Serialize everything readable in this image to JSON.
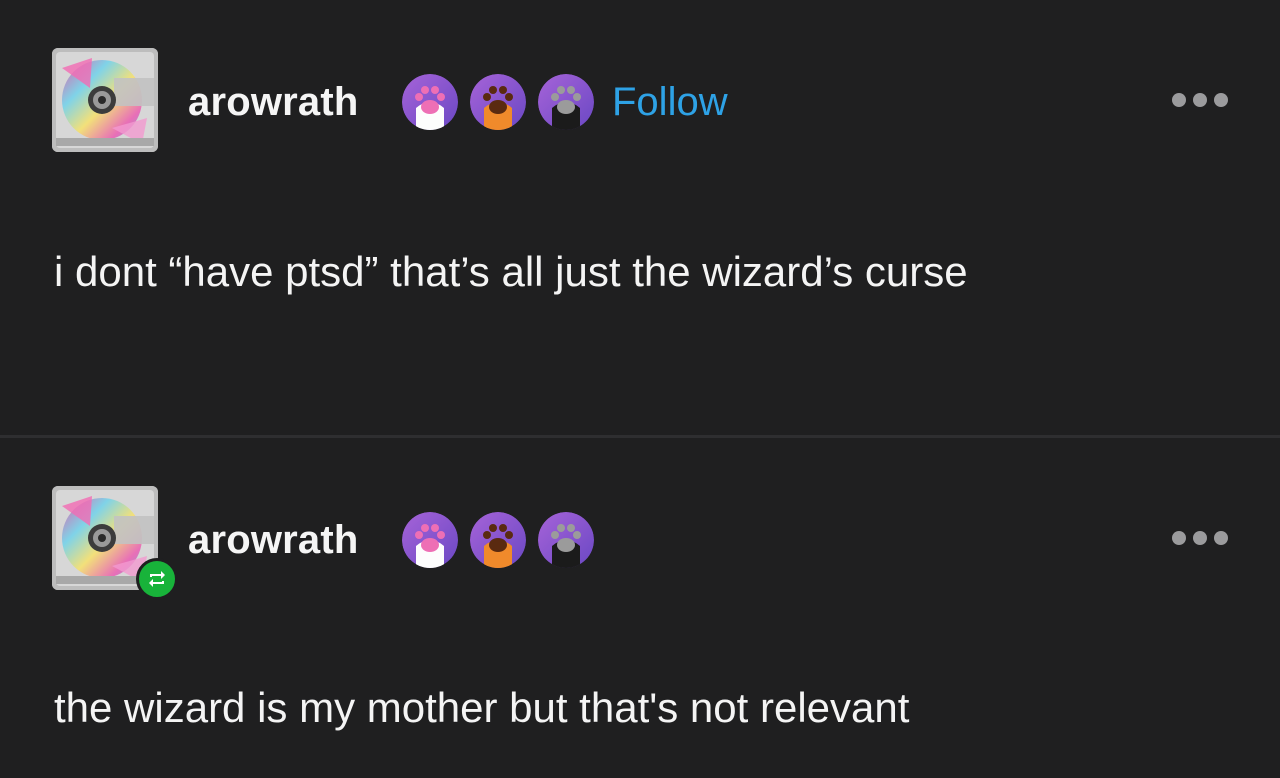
{
  "posts": [
    {
      "username": "arowrath",
      "follow_label": "Follow",
      "text": "i dont “have ptsd” that’s all just the wizard’s curse",
      "badges": [
        "pink-paw-badge-icon",
        "orange-paw-badge-icon",
        "gray-paw-badge-icon"
      ]
    },
    {
      "username": "arowrath",
      "text": "the wizard is my mother but that's not relevant",
      "badges": [
        "pink-paw-badge-icon",
        "orange-paw-badge-icon",
        "gray-paw-badge-icon"
      ],
      "reblog_icon": "reblog-icon"
    }
  ],
  "colors": {
    "background": "#1f1f20",
    "follow": "#2ea2e6",
    "reblog_badge": "#18b33a",
    "text": "#f4f4f4"
  }
}
